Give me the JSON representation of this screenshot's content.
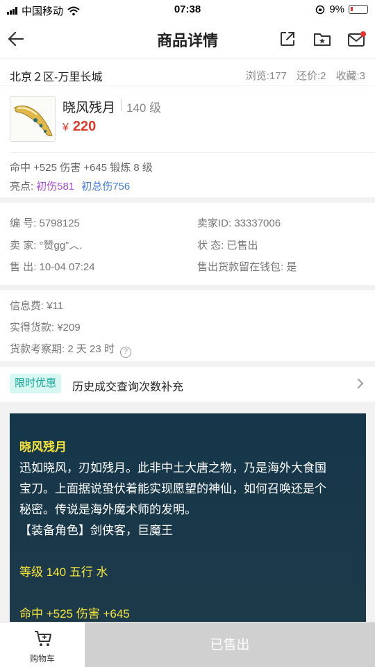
{
  "status_bar": {
    "carrier": "中国移动",
    "time": "07:38",
    "battery": "9%"
  },
  "nav": {
    "title": "商品详情"
  },
  "location": {
    "server": "北京２区-万里长城",
    "views": "浏览:177",
    "bargains": "还价:2",
    "favorites": "收藏:3"
  },
  "item": {
    "name": "晓风残月",
    "level": "140 级",
    "currency": "¥",
    "price": "220",
    "attributes": "命中 +525 伤害 +645 锻炼 8 级",
    "highlight_label": "亮点:",
    "highlight_1": "初伤581",
    "highlight_2": "初总伤756"
  },
  "info": {
    "id": "编 号:  5798125",
    "seller_id": "卖家ID:  33337006",
    "seller": "卖 家:  °赞gg”︿.",
    "status": "状 态:  已售出",
    "sold_at": "售 出:  10-04 07:24",
    "wallet": "售出货款留在钱包:  是"
  },
  "fees": {
    "info_fee": "信息费: ¥11",
    "net_payment": "实得货款: ¥209",
    "hold_period": "货款考察期: 2 天 23 时"
  },
  "promo": {
    "badge": "限时优惠",
    "text": "历史成交查询次数补充"
  },
  "description": {
    "title": "晓风残月",
    "line1": "迅如晓风，刃如残月。此非中土大唐之物，乃是海外大食国",
    "line2": "宝刀。上面据说蛩伏着能实现愿望的神仙，如何召唤还是个",
    "line3": "秘密。传说是海外魔术师的发明。",
    "line4": "【装备角色】剑侠客，巨魔王",
    "level_line": "等级 140 五行 水",
    "stats_line": "命中 +525 伤害 +645"
  },
  "bottom": {
    "cart_label": "购物车",
    "sold_label": "已售出"
  },
  "colors": {
    "price": "#e03a2c",
    "promo": "#1aa99a",
    "desc_bg": "#15364a",
    "gold": "#f6e43b"
  }
}
